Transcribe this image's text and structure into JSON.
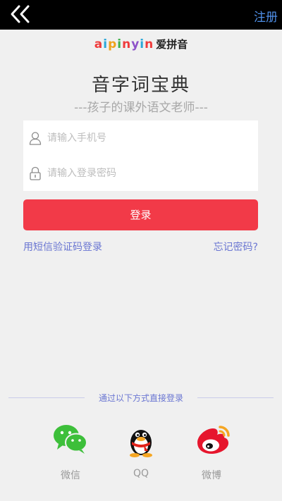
{
  "topbar": {
    "back_icon": "double-chevron-left-icon",
    "register_label": "注册"
  },
  "brand": {
    "latin_letters": [
      "a",
      "i",
      "p",
      "i",
      "n",
      "y",
      "i",
      "n"
    ],
    "chinese": "爱拼音"
  },
  "app": {
    "title": "音字词宝典",
    "subtitle": "---孩子的课外语文老师---"
  },
  "form": {
    "phone": {
      "icon": "user-icon",
      "placeholder": "请输入手机号",
      "value": ""
    },
    "password": {
      "icon": "lock-icon",
      "placeholder": "请输入登录密码",
      "value": ""
    },
    "login_label": "登录",
    "sms_login_label": "用短信验证码登录",
    "forgot_label": "忘记密码?"
  },
  "social": {
    "divider_text": "通过以下方式直接登录",
    "options": [
      {
        "label": "微信",
        "icon": "wechat-icon"
      },
      {
        "label": "QQ",
        "icon": "qq-penguin-icon"
      },
      {
        "label": "微博",
        "icon": "weibo-icon"
      }
    ]
  },
  "colors": {
    "topbar_bg": "#000000",
    "accent_blue": "#4f8fe8",
    "link_purple": "#6a76d2",
    "login_red": "#f23a48",
    "page_bg": "#f0f0f0"
  }
}
